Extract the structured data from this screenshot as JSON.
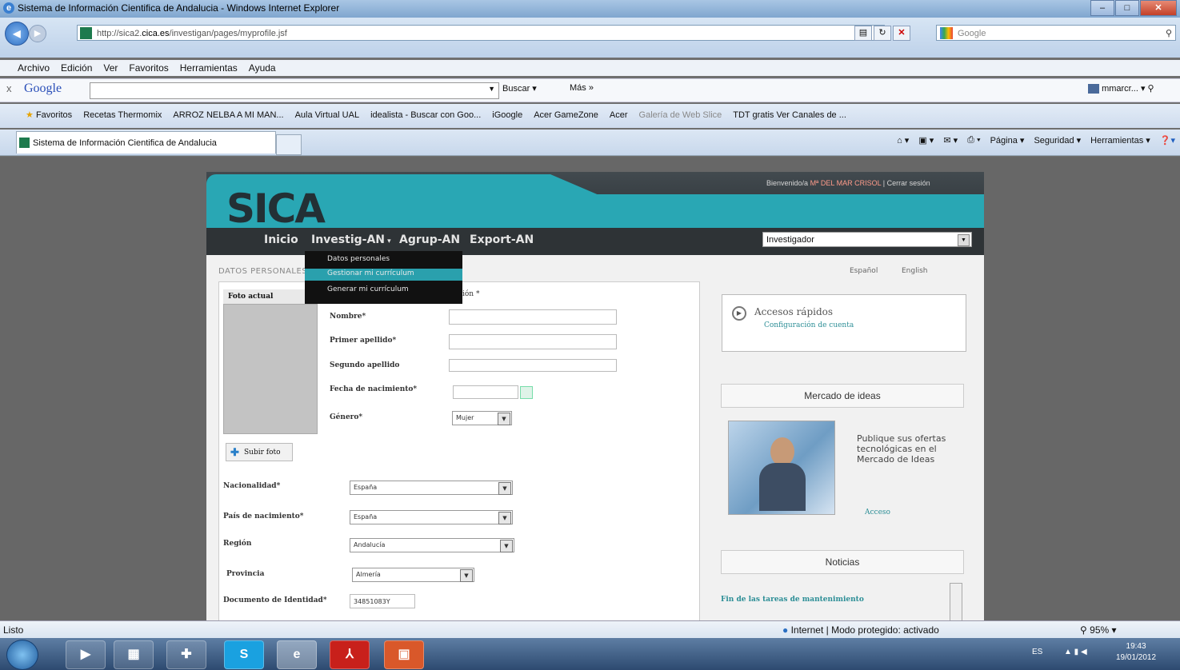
{
  "window": {
    "title": "Sistema de Información Cientifica de Andalucia - Windows Internet Explorer",
    "url_prefix": "http://sica2.",
    "url_domain": "cica.es",
    "url_path": "/investigan/pages/myprofile.jsf",
    "search_engine": "Google"
  },
  "menu": [
    "Archivo",
    "Edición",
    "Ver",
    "Favoritos",
    "Herramientas",
    "Ayuda"
  ],
  "google_bar": {
    "logo": "Google",
    "buscar": "Buscar",
    "mas": "Más »",
    "user": "mmarcr..."
  },
  "favorites": {
    "label": "Favoritos",
    "items": [
      "Recetas Thermomix",
      "ARROZ NELBA A MI MAN...",
      "Aula Virtual UAL",
      "idealista - Buscar con Goo...",
      "iGoogle",
      "Acer GameZone",
      "Acer",
      "Galería de Web Slice",
      "TDT gratis Ver Canales de ..."
    ]
  },
  "tab": {
    "title": "Sistema de Información Cientifica de Andalucia"
  },
  "commandbar": [
    "Página",
    "Seguridad",
    "Herramientas"
  ],
  "site": {
    "logo": "SICA",
    "welcome_prefix": "Bienvenido/a",
    "user_name": "Mª DEL MAR CRISOL",
    "logout": "Cerrar sesión",
    "nav": [
      "Inicio",
      "Investig-AN",
      "Agrup-AN",
      "Export-AN"
    ],
    "role": "Investigador",
    "dropdown": [
      "Datos personales",
      "Gestionar mi currículum",
      "Generar mi currículum"
    ],
    "section_title": "DATOS PERSONALES",
    "photo_label": "Foto actual",
    "upload_label": "Subir foto",
    "identification_suffix": "ión *",
    "fields": {
      "nombre": "Nombre*",
      "apellido1": "Primer apellido*",
      "apellido2": "Segundo apellido",
      "nacimiento": "Fecha de nacimiento*",
      "genero": "Género*",
      "genero_value": "Mujer",
      "nacionalidad": "Nacionalidad*",
      "nacionalidad_value": "España",
      "pais": "País de nacimiento*",
      "pais_value": "España",
      "region": "Región",
      "region_value": "Andalucía",
      "provincia": "Provincia",
      "provincia_value": "Almería",
      "documento": "Documento de Identidad*",
      "documento_value": "34851083Y"
    },
    "languages": [
      "Español",
      "English"
    ],
    "quick_access_title": "Accesos rápidos",
    "quick_access_link": "Configuración de cuenta",
    "ideas_title": "Mercado de ideas",
    "ideas_text": "Publique sus ofertas tecnológicas en el Mercado de Ideas",
    "ideas_link": "Acceso",
    "news_title": "Noticias",
    "news_item": "Fin de las tareas de mantenimiento"
  },
  "status": {
    "left": "Listo",
    "zone": "Internet | Modo protegido: activado",
    "zoom": "95%"
  },
  "taskbar": {
    "lang": "ES",
    "time": "19:43",
    "date": "19/01/2012"
  }
}
